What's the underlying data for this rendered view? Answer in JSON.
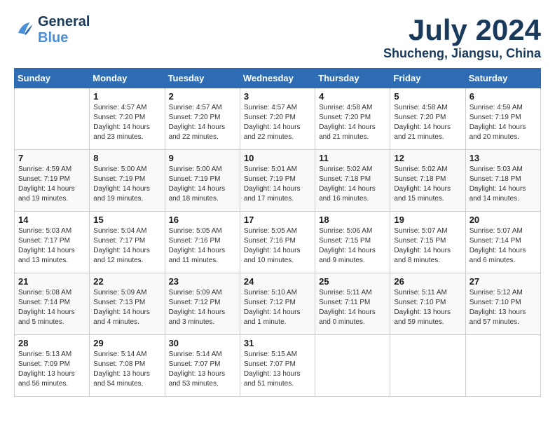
{
  "header": {
    "logo_line1": "General",
    "logo_line2": "Blue",
    "month": "July 2024",
    "location": "Shucheng, Jiangsu, China"
  },
  "weekdays": [
    "Sunday",
    "Monday",
    "Tuesday",
    "Wednesday",
    "Thursday",
    "Friday",
    "Saturday"
  ],
  "weeks": [
    [
      {
        "day": "",
        "content": ""
      },
      {
        "day": "1",
        "content": "Sunrise: 4:57 AM\nSunset: 7:20 PM\nDaylight: 14 hours\nand 23 minutes."
      },
      {
        "day": "2",
        "content": "Sunrise: 4:57 AM\nSunset: 7:20 PM\nDaylight: 14 hours\nand 22 minutes."
      },
      {
        "day": "3",
        "content": "Sunrise: 4:57 AM\nSunset: 7:20 PM\nDaylight: 14 hours\nand 22 minutes."
      },
      {
        "day": "4",
        "content": "Sunrise: 4:58 AM\nSunset: 7:20 PM\nDaylight: 14 hours\nand 21 minutes."
      },
      {
        "day": "5",
        "content": "Sunrise: 4:58 AM\nSunset: 7:20 PM\nDaylight: 14 hours\nand 21 minutes."
      },
      {
        "day": "6",
        "content": "Sunrise: 4:59 AM\nSunset: 7:19 PM\nDaylight: 14 hours\nand 20 minutes."
      }
    ],
    [
      {
        "day": "7",
        "content": "Sunrise: 4:59 AM\nSunset: 7:19 PM\nDaylight: 14 hours\nand 19 minutes."
      },
      {
        "day": "8",
        "content": "Sunrise: 5:00 AM\nSunset: 7:19 PM\nDaylight: 14 hours\nand 19 minutes."
      },
      {
        "day": "9",
        "content": "Sunrise: 5:00 AM\nSunset: 7:19 PM\nDaylight: 14 hours\nand 18 minutes."
      },
      {
        "day": "10",
        "content": "Sunrise: 5:01 AM\nSunset: 7:19 PM\nDaylight: 14 hours\nand 17 minutes."
      },
      {
        "day": "11",
        "content": "Sunrise: 5:02 AM\nSunset: 7:18 PM\nDaylight: 14 hours\nand 16 minutes."
      },
      {
        "day": "12",
        "content": "Sunrise: 5:02 AM\nSunset: 7:18 PM\nDaylight: 14 hours\nand 15 minutes."
      },
      {
        "day": "13",
        "content": "Sunrise: 5:03 AM\nSunset: 7:18 PM\nDaylight: 14 hours\nand 14 minutes."
      }
    ],
    [
      {
        "day": "14",
        "content": "Sunrise: 5:03 AM\nSunset: 7:17 PM\nDaylight: 14 hours\nand 13 minutes."
      },
      {
        "day": "15",
        "content": "Sunrise: 5:04 AM\nSunset: 7:17 PM\nDaylight: 14 hours\nand 12 minutes."
      },
      {
        "day": "16",
        "content": "Sunrise: 5:05 AM\nSunset: 7:16 PM\nDaylight: 14 hours\nand 11 minutes."
      },
      {
        "day": "17",
        "content": "Sunrise: 5:05 AM\nSunset: 7:16 PM\nDaylight: 14 hours\nand 10 minutes."
      },
      {
        "day": "18",
        "content": "Sunrise: 5:06 AM\nSunset: 7:15 PM\nDaylight: 14 hours\nand 9 minutes."
      },
      {
        "day": "19",
        "content": "Sunrise: 5:07 AM\nSunset: 7:15 PM\nDaylight: 14 hours\nand 8 minutes."
      },
      {
        "day": "20",
        "content": "Sunrise: 5:07 AM\nSunset: 7:14 PM\nDaylight: 14 hours\nand 6 minutes."
      }
    ],
    [
      {
        "day": "21",
        "content": "Sunrise: 5:08 AM\nSunset: 7:14 PM\nDaylight: 14 hours\nand 5 minutes."
      },
      {
        "day": "22",
        "content": "Sunrise: 5:09 AM\nSunset: 7:13 PM\nDaylight: 14 hours\nand 4 minutes."
      },
      {
        "day": "23",
        "content": "Sunrise: 5:09 AM\nSunset: 7:12 PM\nDaylight: 14 hours\nand 3 minutes."
      },
      {
        "day": "24",
        "content": "Sunrise: 5:10 AM\nSunset: 7:12 PM\nDaylight: 14 hours\nand 1 minute."
      },
      {
        "day": "25",
        "content": "Sunrise: 5:11 AM\nSunset: 7:11 PM\nDaylight: 14 hours\nand 0 minutes."
      },
      {
        "day": "26",
        "content": "Sunrise: 5:11 AM\nSunset: 7:10 PM\nDaylight: 13 hours\nand 59 minutes."
      },
      {
        "day": "27",
        "content": "Sunrise: 5:12 AM\nSunset: 7:10 PM\nDaylight: 13 hours\nand 57 minutes."
      }
    ],
    [
      {
        "day": "28",
        "content": "Sunrise: 5:13 AM\nSunset: 7:09 PM\nDaylight: 13 hours\nand 56 minutes."
      },
      {
        "day": "29",
        "content": "Sunrise: 5:14 AM\nSunset: 7:08 PM\nDaylight: 13 hours\nand 54 minutes."
      },
      {
        "day": "30",
        "content": "Sunrise: 5:14 AM\nSunset: 7:07 PM\nDaylight: 13 hours\nand 53 minutes."
      },
      {
        "day": "31",
        "content": "Sunrise: 5:15 AM\nSunset: 7:07 PM\nDaylight: 13 hours\nand 51 minutes."
      },
      {
        "day": "",
        "content": ""
      },
      {
        "day": "",
        "content": ""
      },
      {
        "day": "",
        "content": ""
      }
    ]
  ]
}
